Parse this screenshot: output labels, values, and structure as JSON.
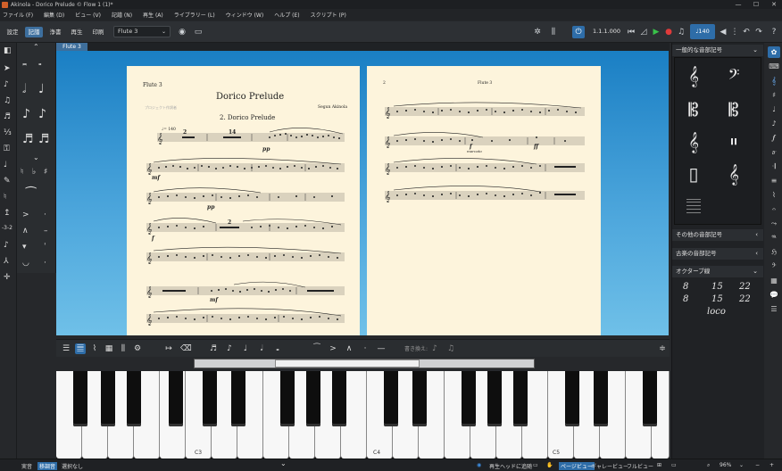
{
  "window": {
    "title": "Akinola - Dorico Prelude © Flow 1 (1)*",
    "min": "—",
    "max": "☐",
    "close": "✕"
  },
  "menu": [
    "ファイル (F)",
    "編集 (D)",
    "ビュー (V)",
    "記譜 (N)",
    "再生 (A)",
    "ライブラリー (L)",
    "ウィンドウ (W)",
    "ヘルプ (E)",
    "スクリプト (P)"
  ],
  "modes": {
    "setup": "設定",
    "write": "記譜",
    "engrave": "浄書",
    "play": "再生",
    "print": "印刷"
  },
  "layout_select": {
    "value": "Flute 3"
  },
  "transport": {
    "timecode": "1.1.1.000",
    "tempo": "♩140"
  },
  "tab": {
    "label": "Flute 3"
  },
  "score": {
    "page1": {
      "part_name": "Flute 3",
      "title": "Dorico Prelude",
      "subtitle": "2. Dorico Prelude",
      "composer": "Segun Akinola",
      "copyright": "プロジェクト作詞者",
      "tempo_mark": "♩= 140",
      "dynamics": [
        "mf",
        "pp",
        "f",
        "mf",
        "pp"
      ],
      "rests": [
        "2",
        "14",
        "2"
      ]
    },
    "page2": {
      "page_number": "2",
      "part_name": "Flute 3",
      "marking": "marcato",
      "dynamics": [
        "f",
        "ff"
      ]
    }
  },
  "right_panel": {
    "common_clefs": "一般的な音部記号",
    "other_clefs": "その他の音部記号",
    "old_clefs": "古楽の音部記号",
    "octave_lines": "オクターブ線",
    "octave_items": [
      "8",
      "15",
      "22",
      "8",
      "15",
      "22"
    ],
    "loco": "loco"
  },
  "lower_toolbar": {
    "rewrite_label": "書き換え:"
  },
  "keyboard": {
    "labels": [
      "C3",
      "C4",
      "C5"
    ]
  },
  "status": {
    "insert_mode": "実音",
    "selection_mode": "移調音",
    "selection": "選択なし",
    "playhead_follow": "再生ヘッドに追随",
    "page_view": "ページビュー",
    "galley_view": "ギャレービュー",
    "full_view": "フルビュー",
    "zoom": "96%"
  },
  "colors": {
    "accent": "#2e6da8",
    "canvas": "#1a7fc4",
    "page": "#fdf4dc",
    "panel": "#202225"
  }
}
